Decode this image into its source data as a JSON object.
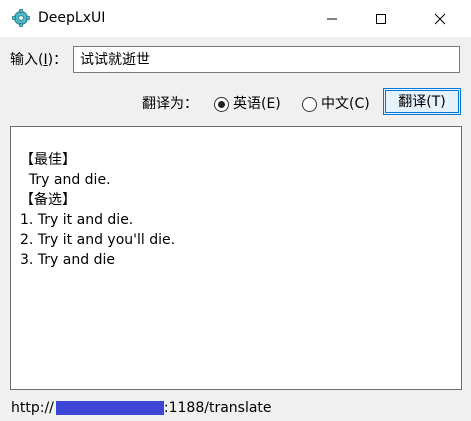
{
  "window": {
    "title": "DeepLxUI",
    "icon": "gear-cog-icon",
    "minimize_icon": "minimize-icon",
    "maximize_icon": "maximize-icon",
    "close_icon": "close-icon"
  },
  "input": {
    "label_prefix": "输入(",
    "label_accel": "I",
    "label_suffix": ")：",
    "value": "试试就逝世"
  },
  "target": {
    "label": "翻译为：",
    "options": [
      {
        "label": "英语(E)",
        "selected": true
      },
      {
        "label": "中文(C)",
        "selected": false
      }
    ]
  },
  "translate_button": {
    "label": "翻译(T)"
  },
  "output": {
    "lines": [
      "【最佳】",
      "  Try and die.",
      "【备选】",
      "1. Try it and die.",
      "2. Try it and you'll die.",
      "3. Try and die"
    ]
  },
  "status": {
    "prefix": "http://",
    "suffix": ":1188/translate",
    "redaction_color": "#3d47d6"
  },
  "colors": {
    "accent": "#0078d7",
    "background": "#f0f0f0"
  }
}
